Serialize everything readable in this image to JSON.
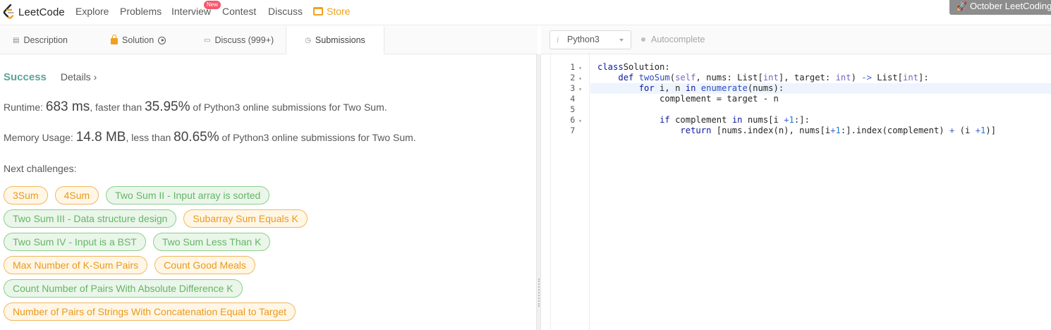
{
  "nav": {
    "logo_text": "LeetCode",
    "items": [
      "Explore",
      "Problems",
      "Interview",
      "Contest",
      "Discuss"
    ],
    "new_badge": "New",
    "store_label": "Store",
    "promo_label": "October LeetCoding"
  },
  "tabs": {
    "description": "Description",
    "solution": "Solution",
    "discuss": "Discuss (999+)",
    "submissions": "Submissions"
  },
  "result": {
    "status": "Success",
    "details_link": "Details ›",
    "runtime": {
      "label": "Runtime: ",
      "value": "683 ms",
      "middle": ", faster than ",
      "percent": "35.95%",
      "suffix": " of Python3 online submissions for Two Sum."
    },
    "memory": {
      "label": "Memory Usage: ",
      "value": "14.8 MB",
      "middle": ", less than ",
      "percent": "80.65%",
      "suffix": " of Python3 online submissions for Two Sum."
    },
    "next_label": "Next challenges:",
    "challenges": [
      [
        {
          "title": "3Sum",
          "difficulty": "medium"
        },
        {
          "title": "4Sum",
          "difficulty": "medium"
        },
        {
          "title": "Two Sum II - Input array is sorted",
          "difficulty": "easy"
        }
      ],
      [
        {
          "title": "Two Sum III - Data structure design",
          "difficulty": "easy"
        },
        {
          "title": "Subarray Sum Equals K",
          "difficulty": "medium"
        }
      ],
      [
        {
          "title": "Two Sum IV - Input is a BST",
          "difficulty": "easy"
        },
        {
          "title": "Two Sum Less Than K",
          "difficulty": "easy"
        }
      ],
      [
        {
          "title": "Max Number of K-Sum Pairs",
          "difficulty": "medium"
        },
        {
          "title": "Count Good Meals",
          "difficulty": "medium"
        }
      ],
      [
        {
          "title": "Count Number of Pairs With Absolute Difference K",
          "difficulty": "easy"
        }
      ],
      [
        {
          "title": "Number of Pairs of Strings With Concatenation Equal to Target",
          "difficulty": "medium"
        }
      ]
    ]
  },
  "editor": {
    "language": "Python3",
    "autocomplete_label": "Autocomplete",
    "active_line": 3,
    "lines": [
      {
        "no": "1",
        "fold": true,
        "tokens": [
          [
            "kw",
            "class"
          ],
          [
            "",
            "Solution:"
          ]
        ]
      },
      {
        "no": "2",
        "fold": true,
        "tokens": [
          [
            "",
            "    "
          ],
          [
            "kw",
            "def"
          ],
          [
            "",
            ""
          ],
          [
            "fn",
            "twoSum"
          ],
          [
            "",
            "("
          ],
          [
            "ty",
            "self"
          ],
          [
            "",
            ", nums: List["
          ],
          [
            "ty",
            "int"
          ],
          [
            "",
            "], target: "
          ],
          [
            "ty",
            "int"
          ],
          [
            "",
            ") "
          ],
          [
            "op",
            "->"
          ],
          [
            "",
            " List["
          ],
          [
            "ty",
            "int"
          ],
          [
            "",
            "]:"
          ]
        ]
      },
      {
        "no": "3",
        "fold": true,
        "tokens": [
          [
            "",
            "        "
          ],
          [
            "kw",
            "for"
          ],
          [
            "",
            " i, n "
          ],
          [
            "kw",
            "in"
          ],
          [
            "",
            ""
          ],
          [
            "fn",
            "enumerate"
          ],
          [
            "",
            "(nums):"
          ]
        ]
      },
      {
        "no": "4",
        "fold": false,
        "tokens": [
          [
            "",
            "            complement = target - n"
          ]
        ]
      },
      {
        "no": "5",
        "fold": false,
        "tokens": [
          [
            "",
            ""
          ]
        ]
      },
      {
        "no": "6",
        "fold": true,
        "tokens": [
          [
            "",
            "            "
          ],
          [
            "kw",
            "if"
          ],
          [
            "",
            " complement "
          ],
          [
            "kw",
            "in"
          ],
          [
            "",
            " nums[i "
          ],
          [
            "op",
            "+"
          ],
          [
            "",
            ""
          ],
          [
            "num",
            "1"
          ],
          [
            "",
            ":]:"
          ]
        ]
      },
      {
        "no": "7",
        "fold": false,
        "tokens": [
          [
            "",
            "                "
          ],
          [
            "kw",
            "return"
          ],
          [
            "",
            " [nums.index(n), nums[i"
          ],
          [
            "op",
            "+"
          ],
          [
            "num",
            "1"
          ],
          [
            "",
            ":].index(complement) "
          ],
          [
            "op",
            "+"
          ],
          [
            "",
            " (i "
          ],
          [
            "op",
            "+"
          ],
          [
            "",
            ""
          ],
          [
            "num",
            "1"
          ],
          [
            "",
            ")]"
          ]
        ]
      }
    ]
  },
  "colors": {
    "success": "#5aa597",
    "easy_text": "#66b566",
    "medium_text": "#ea9a1d",
    "store": "#f0a020"
  }
}
